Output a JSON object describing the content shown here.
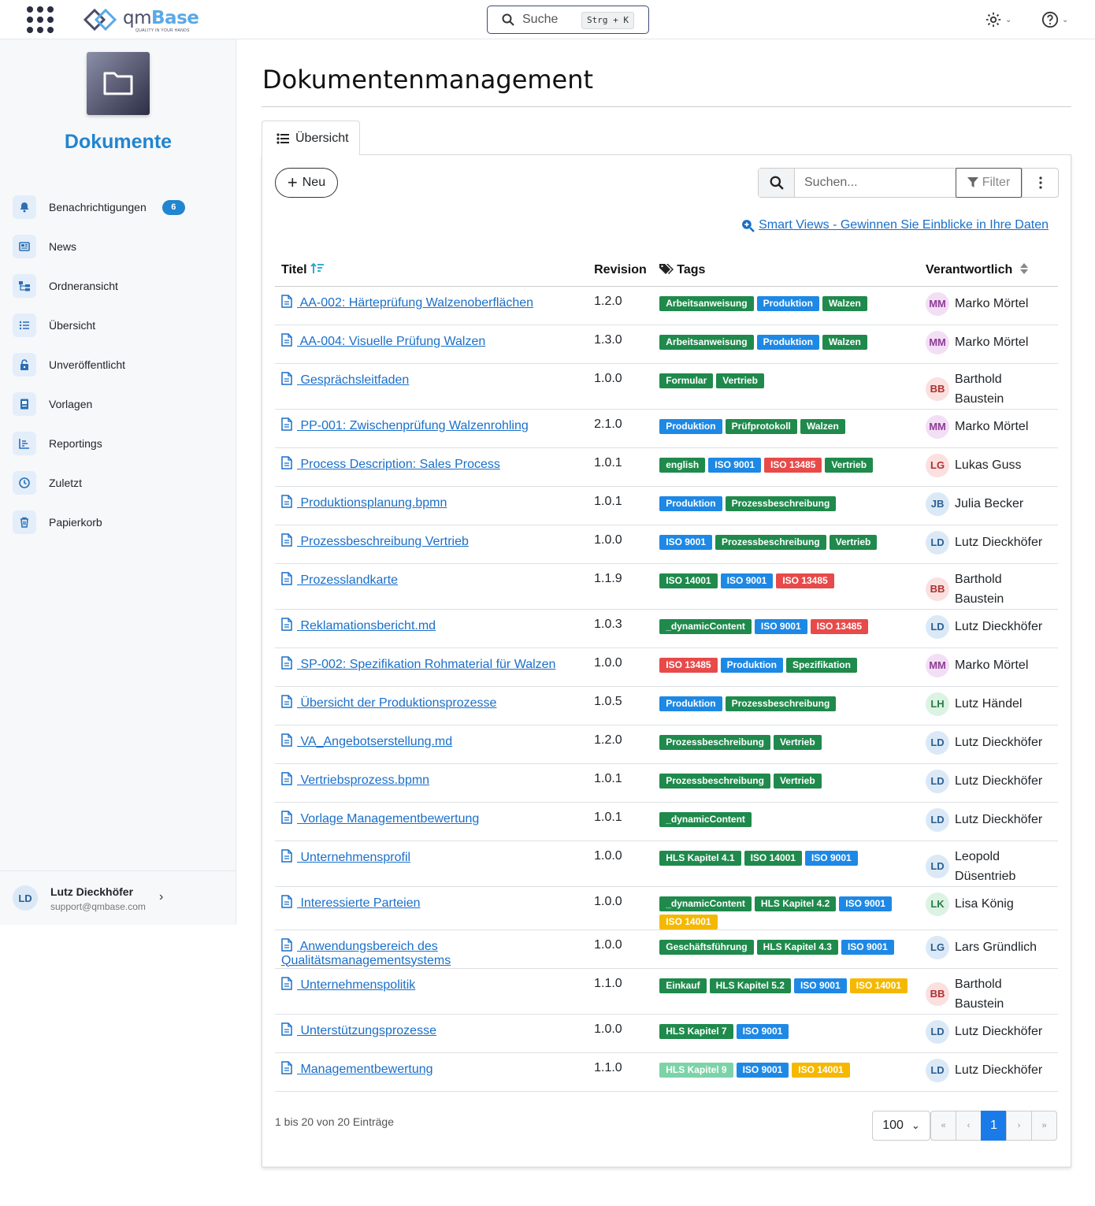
{
  "topbar": {
    "logo_text_a": "qm",
    "logo_text_b": "Base",
    "logo_tagline": "QUALITY IN YOUR HANDS",
    "search_label": "Suche",
    "search_shortcut": "Strg + K"
  },
  "sidebar": {
    "title": "Dokumente",
    "items": [
      {
        "label": "Benachrichtigungen",
        "icon": "bell-icon",
        "badge": "6"
      },
      {
        "label": "News",
        "icon": "newspaper-icon"
      },
      {
        "label": "Ordneransicht",
        "icon": "folder-tree-icon"
      },
      {
        "label": "Übersicht",
        "icon": "list-icon"
      },
      {
        "label": "Unveröffentlicht",
        "icon": "lock-icon"
      },
      {
        "label": "Vorlagen",
        "icon": "template-icon"
      },
      {
        "label": "Reportings",
        "icon": "chart-icon"
      },
      {
        "label": "Zuletzt",
        "icon": "clock-icon"
      },
      {
        "label": "Papierkorb",
        "icon": "trash-icon"
      }
    ],
    "user": {
      "initials": "LD",
      "name": "Lutz Dieckhöfer",
      "email": "support@qmbase.com"
    }
  },
  "main": {
    "title": "Dokumentenmanagement",
    "tab_label": "Übersicht",
    "new_label": "Neu",
    "search_placeholder": "Suchen...",
    "filter_label": "Filter",
    "smart_views": " Smart Views - Gewinnen Sie Einblicke in Ihre Daten",
    "columns": {
      "title": "Titel",
      "revision": "Revision",
      "tags": "Tags",
      "owner": "Verantwortlich"
    },
    "footer_info": "1 bis 20 von 20 Einträge",
    "page_size": "100",
    "pages": {
      "first": "«",
      "prev": "‹",
      "current": "1",
      "next": "›",
      "last": "»"
    }
  },
  "tag_colors": {
    "Arbeitsanweisung": "#1f8a4c",
    "Produktion": "#1e88e5",
    "Walzen": "#1f8a4c",
    "Formular": "#1f8a4c",
    "Vertrieb": "#1f8a4c",
    "Prüfprotokoll": "#1f8a4c",
    "english": "#1f8a4c",
    "ISO 9001": "#1e88e5",
    "ISO 13485": "#e84a4a",
    "Prozessbeschreibung": "#1f8a4c",
    "ISO 14001": "#1f8a4c",
    "_dynamicContent": "#1f8a4c",
    "Spezifikation": "#1f8a4c",
    "HLS Kapitel 4.1": "#1f8a4c",
    "HLS Kapitel 4.2": "#1f8a4c",
    "HLS Kapitel 4.3": "#1f8a4c",
    "HLS Kapitel 5.2": "#1f8a4c",
    "HLS Kapitel 7": "#1f8a4c",
    "HLS Kapitel 9": "#7dd3a8",
    "Geschäftsführung": "#1f8a4c",
    "Einkauf": "#1f8a4c",
    "ISO 14001 (gelb)": "#f5b800"
  },
  "avatar_colors": {
    "MM": {
      "bg": "#f3dff5",
      "fg": "#8e3b97"
    },
    "BB": {
      "bg": "#fbe0e0",
      "fg": "#b03030"
    },
    "LG": {
      "bg": "#fbe0e0",
      "fg": "#b03030"
    },
    "JB": {
      "bg": "#dbe9f7",
      "fg": "#2c5f8f"
    },
    "LD": {
      "bg": "#dbe9f7",
      "fg": "#2c5f8f"
    },
    "LH": {
      "bg": "#dcf3e3",
      "fg": "#2a7a45"
    },
    "LK": {
      "bg": "#dcf3e3",
      "fg": "#2a7a45"
    },
    "LG2": {
      "bg": "#dbe9f7",
      "fg": "#2c5f8f"
    }
  },
  "rows": [
    {
      "title": " AA-002: Härteprüfung Walzenoberflächen",
      "rev": "1.2.0",
      "tags": [
        "Arbeitsanweisung",
        "Produktion",
        "Walzen"
      ],
      "initials": "MM",
      "owner": "Marko Mörtel"
    },
    {
      "title": " AA-004: Visuelle Prüfung Walzen",
      "rev": "1.3.0",
      "tags": [
        "Arbeitsanweisung",
        "Produktion",
        "Walzen"
      ],
      "initials": "MM",
      "owner": "Marko Mörtel"
    },
    {
      "title": " Gesprächsleitfaden",
      "rev": "1.0.0",
      "tags": [
        "Formular",
        "Vertrieb"
      ],
      "initials": "BB",
      "owner": "Barthold Baustein"
    },
    {
      "title": " PP-001: Zwischenprüfung Walzenrohling",
      "rev": "2.1.0",
      "tags": [
        "Produktion",
        "Prüfprotokoll",
        "Walzen"
      ],
      "initials": "MM",
      "owner": "Marko Mörtel"
    },
    {
      "title": " Process Description: Sales Process",
      "rev": "1.0.1",
      "tags": [
        "english",
        "ISO 9001",
        "ISO 13485",
        "Vertrieb"
      ],
      "initials": "LG",
      "owner": "Lukas Guss"
    },
    {
      "title": " Produktionsplanung.bpmn",
      "rev": "1.0.1",
      "tags": [
        "Produktion",
        "Prozessbeschreibung"
      ],
      "initials": "JB",
      "owner": "Julia Becker"
    },
    {
      "title": " Prozessbeschreibung Vertrieb",
      "rev": "1.0.0",
      "tags": [
        "ISO 9001",
        "Prozessbeschreibung",
        "Vertrieb"
      ],
      "initials": "LD",
      "owner": "Lutz Dieckhöfer"
    },
    {
      "title": " Prozesslandkarte",
      "rev": "1.1.9",
      "tags": [
        "ISO 14001",
        "ISO 9001",
        "ISO 13485"
      ],
      "initials": "BB",
      "owner": "Barthold Baustein"
    },
    {
      "title": " Reklamationsbericht.md",
      "rev": "1.0.3",
      "tags": [
        "_dynamicContent",
        "ISO 9001",
        "ISO 13485"
      ],
      "initials": "LD",
      "owner": "Lutz Dieckhöfer"
    },
    {
      "title": " SP-002: Spezifikation Rohmaterial für Walzen",
      "rev": "1.0.0",
      "tags": [
        "ISO 13485",
        "Produktion",
        "Spezifikation"
      ],
      "initials": "MM",
      "owner": "Marko Mörtel"
    },
    {
      "title": " Übersicht der Produktionsprozesse",
      "rev": "1.0.5",
      "tags": [
        "Produktion",
        "Prozessbeschreibung"
      ],
      "initials": "LH",
      "owner": "Lutz Händel"
    },
    {
      "title": " VA_Angebotserstellung.md",
      "rev": "1.2.0",
      "tags": [
        "Prozessbeschreibung",
        "Vertrieb"
      ],
      "initials": "LD",
      "owner": "Lutz Dieckhöfer"
    },
    {
      "title": " Vertriebsprozess.bpmn",
      "rev": "1.0.1",
      "tags": [
        "Prozessbeschreibung",
        "Vertrieb"
      ],
      "initials": "LD",
      "owner": "Lutz Dieckhöfer"
    },
    {
      "title": " Vorlage Managementbewertung",
      "rev": "1.0.1",
      "tags": [
        "_dynamicContent"
      ],
      "initials": "LD",
      "owner": "Lutz Dieckhöfer"
    },
    {
      "title": " Unternehmensprofil",
      "rev": "1.0.0",
      "tags": [
        "HLS Kapitel 4.1",
        "ISO 14001",
        "ISO 9001"
      ],
      "initials": "LD",
      "owner": "Leopold Düsentrieb"
    },
    {
      "title": " Interessierte Parteien",
      "rev": "1.0.0",
      "tags": [
        "_dynamicContent",
        "HLS Kapitel 4.2",
        "ISO 9001",
        "ISO 14001*"
      ],
      "initials": "LK",
      "owner": "Lisa König"
    },
    {
      "title": " Anwendungsbereich des Qualitätsmanagementsystems",
      "rev": "1.0.0",
      "tags": [
        "Geschäftsführung",
        "HLS Kapitel 4.3",
        "ISO 9001"
      ],
      "initials": "LG2",
      "owner": "Lars Gründlich"
    },
    {
      "title": " Unternehmenspolitik",
      "rev": "1.1.0",
      "tags": [
        "Einkauf",
        "HLS Kapitel 5.2",
        "ISO 9001",
        "ISO 14001*"
      ],
      "initials": "BB",
      "owner": "Barthold Baustein"
    },
    {
      "title": " Unterstützungsprozesse",
      "rev": "1.0.0",
      "tags": [
        "HLS Kapitel 7",
        "ISO 9001"
      ],
      "initials": "LD",
      "owner": "Lutz Dieckhöfer"
    },
    {
      "title": " Managementbewertung",
      "rev": "1.1.0",
      "tags": [
        "HLS Kapitel 9",
        "ISO 9001",
        "ISO 14001*"
      ],
      "initials": "LD",
      "owner": "Lutz Dieckhöfer"
    }
  ]
}
